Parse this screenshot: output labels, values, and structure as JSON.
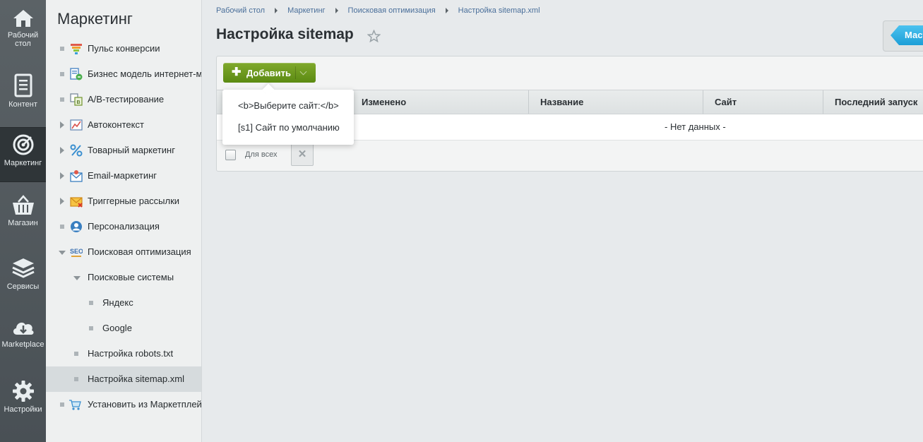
{
  "rail": [
    {
      "label": "Рабочий стол",
      "icon": "home-icon"
    },
    {
      "label": "Контент",
      "icon": "document-icon"
    },
    {
      "label": "Маркетинг",
      "icon": "target-icon"
    },
    {
      "label": "Магазин",
      "icon": "basket-icon"
    },
    {
      "label": "Сервисы",
      "icon": "layers-icon"
    },
    {
      "label": "Marketplace",
      "icon": "cloud-download-icon"
    },
    {
      "label": "Настройки",
      "icon": "gear-icon"
    }
  ],
  "sidebar": {
    "title": "Маркетинг",
    "items": [
      {
        "label": "Пульс конверсии",
        "icon": "funnel-icon"
      },
      {
        "label": "Бизнес модель интернет-магазина",
        "icon": "business-model-icon"
      },
      {
        "label": "A/B-тестирование",
        "icon": "ab-test-icon"
      },
      {
        "label": "Автоконтекст",
        "icon": "autocontext-icon"
      },
      {
        "label": "Товарный маркетинг",
        "icon": "percent-icon"
      },
      {
        "label": "Email-маркетинг",
        "icon": "email-icon"
      },
      {
        "label": "Триггерные рассылки",
        "icon": "trigger-mail-icon"
      },
      {
        "label": "Персонализация",
        "icon": "person-icon"
      },
      {
        "label": "Поисковая оптимизация",
        "icon": "seo-icon"
      },
      {
        "label": "Поисковые системы"
      },
      {
        "label": "Яндекс"
      },
      {
        "label": "Google"
      },
      {
        "label": "Настройка robots.txt"
      },
      {
        "label": "Настройка sitemap.xml"
      },
      {
        "label": "Установить из Маркетплейса",
        "icon": "cart-icon"
      }
    ]
  },
  "breadcrumb": [
    "Рабочий стол",
    "Маркетинг",
    "Поисковая оптимизация",
    "Настройка sitemap.xml"
  ],
  "page": {
    "title": "Настройка sitemap"
  },
  "toolbar": {
    "add_label": "Добавить",
    "master_label": "Мастер"
  },
  "add_menu": {
    "options": [
      "<b>Выберите сайт:</b>",
      "[s1] Сайт по умолчанию"
    ]
  },
  "table": {
    "columns": [
      "Изменено",
      "Название",
      "Сайт",
      "Последний запуск"
    ],
    "empty_text": "- Нет данных -"
  },
  "footer": {
    "for_all_label": "Для всех",
    "delete_symbol": "✕"
  },
  "colors": {
    "accent_green": "#6b9a1c",
    "rail_bg": "#4f565a",
    "link": "#4a6f9a",
    "master_blue": "#1d9fd7"
  }
}
